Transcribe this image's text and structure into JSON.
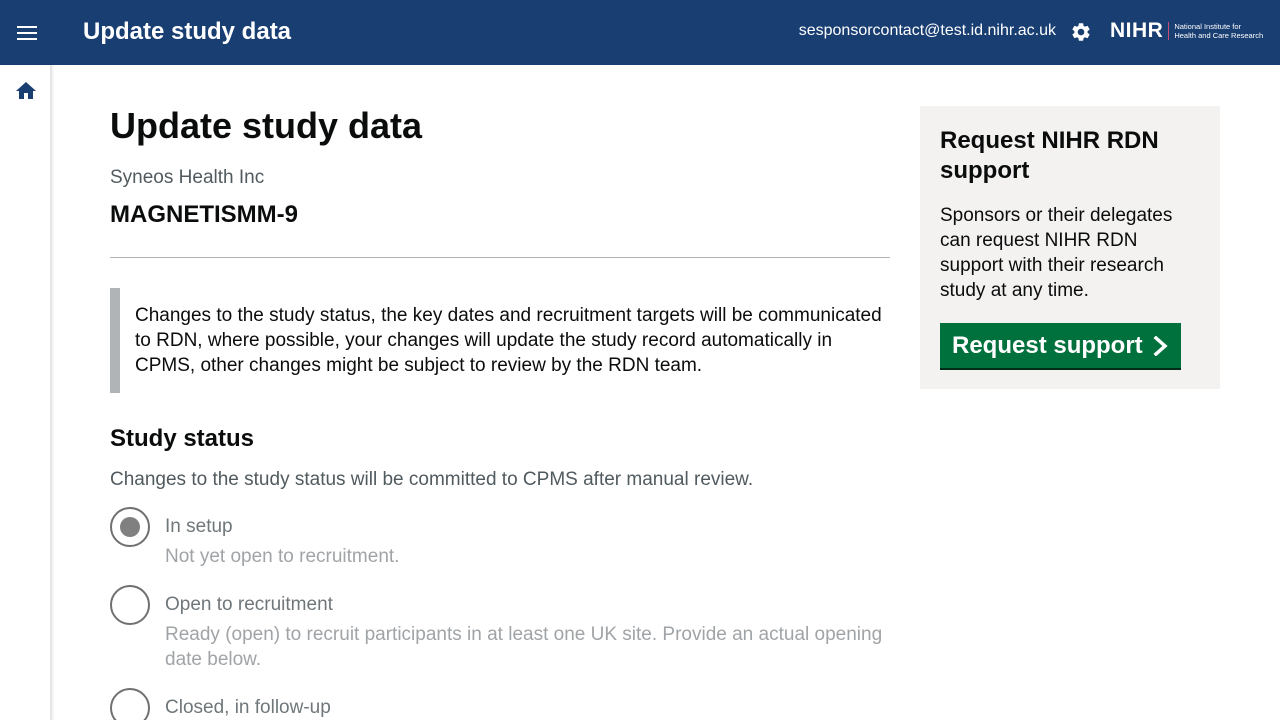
{
  "header": {
    "title": "Update study data",
    "user_email": "sesponsorcontact@test.id.nihr.ac.uk",
    "logo_main": "NIHR",
    "logo_sub_line1": "National Institute for",
    "logo_sub_line2": "Health and Care Research"
  },
  "main": {
    "page_title": "Update study data",
    "organisation": "Syneos Health Inc",
    "study_name": "MAGNETISMM-9",
    "inset_text": "Changes to the study status, the key dates and recruitment targets will be communicated to RDN, where possible, your changes will update the study record automatically in CPMS, other changes might be subject to review by the RDN team.",
    "study_status": {
      "heading": "Study status",
      "hint": "Changes to the study status will be committed to CPMS after manual review.",
      "options": [
        {
          "label": "In setup",
          "hint": "Not yet open to recruitment.",
          "checked": true
        },
        {
          "label": "Open to recruitment",
          "hint": "Ready (open) to recruit participants in at least one UK site. Provide an actual opening date below.",
          "checked": false
        },
        {
          "label": "Closed, in follow-up",
          "hint": "",
          "checked": false
        }
      ]
    }
  },
  "aside": {
    "title": "Request NIHR RDN support",
    "body": "Sponsors or their delegates can request NIHR RDN support with their research study at any time.",
    "button_label": "Request support"
  },
  "icons": [
    "menu-icon",
    "settings-icon",
    "home-icon",
    "chevron-right-icon"
  ],
  "colors": {
    "header_bg": "#193e72",
    "button_green": "#00703c",
    "aside_bg": "#f3f2f1"
  }
}
